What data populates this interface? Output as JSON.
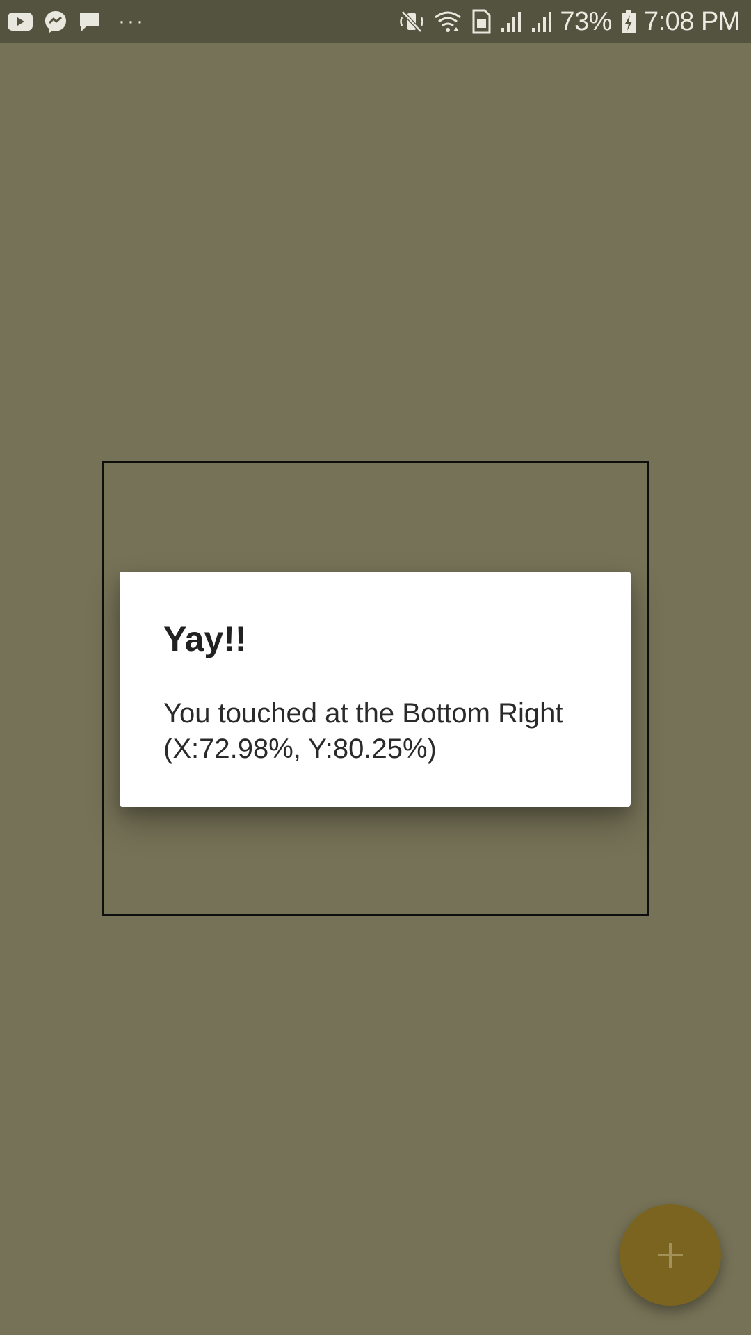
{
  "status_bar": {
    "left_icons": [
      "youtube-icon",
      "messenger-icon",
      "message-icon"
    ],
    "more_label": "···",
    "right_icons": [
      "mute-icon",
      "wifi-icon",
      "sim-icon",
      "signal-icon",
      "signal-icon",
      "battery-charging-icon"
    ],
    "battery": "73%",
    "time": "7:08 PM"
  },
  "dialog": {
    "title": "Yay!!",
    "message_line1": "You touched at the Bottom Right",
    "message_line2": "(X:72.98%, Y:80.25%)"
  },
  "fab": {
    "icon": "plus-icon"
  },
  "colors": {
    "background": "#767257",
    "status_bar": "#54533f",
    "fab": "#7a6420",
    "dialog": "#ffffff"
  }
}
